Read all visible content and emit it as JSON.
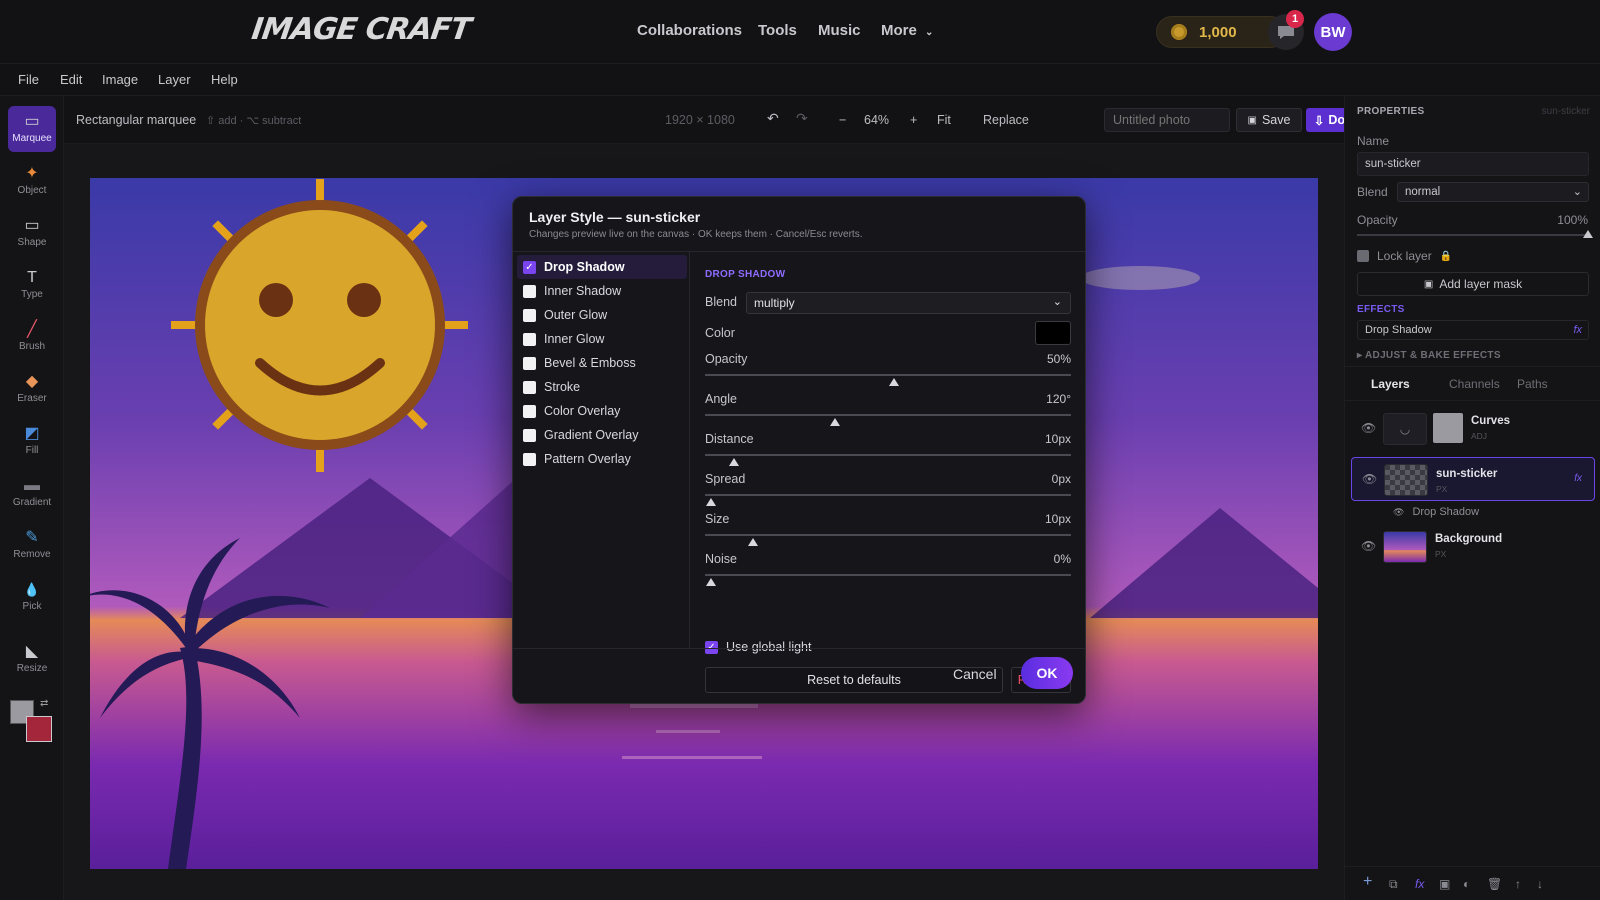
{
  "app": {
    "logo": "IMAGE CRAFT",
    "nav": [
      "Collaborations",
      "Tools",
      "Music",
      "More"
    ],
    "coins": "1,000",
    "notifications": "1",
    "avatar": "BW"
  },
  "menu": [
    "File",
    "Edit",
    "Image",
    "Layer",
    "Help"
  ],
  "tools": [
    {
      "label": "Marquee",
      "icon": "marquee-icon",
      "glyph": "▭",
      "active": true
    },
    {
      "label": "Object",
      "icon": "object-icon",
      "glyph": "✦"
    },
    {
      "label": "Shape",
      "icon": "shape-icon",
      "glyph": "▭"
    },
    {
      "label": "Type",
      "icon": "type-icon",
      "glyph": "T"
    },
    {
      "label": "Brush",
      "icon": "brush-icon",
      "glyph": "╱"
    },
    {
      "label": "Eraser",
      "icon": "eraser-icon",
      "glyph": "◆"
    },
    {
      "label": "Fill",
      "icon": "fill-icon",
      "glyph": "◩"
    },
    {
      "label": "Gradient",
      "icon": "gradient-icon",
      "glyph": "▬"
    },
    {
      "label": "Remove",
      "icon": "remove-icon",
      "glyph": "✎"
    },
    {
      "label": "Pick",
      "icon": "pick-icon",
      "glyph": "💧"
    },
    {
      "label": "Resize",
      "icon": "resize-icon",
      "glyph": "◣"
    }
  ],
  "colors": {
    "foreground": "#9a9aa0",
    "background": "#a3263a",
    "accent": "#6a45e8",
    "danger": "#ef4d6a"
  },
  "options": {
    "tool_name": "Rectangular marquee",
    "tool_hint": "⇧ add · ⌥ subtract",
    "dimensions": "1920 × 1080",
    "zoom": "64%",
    "fit": "Fit",
    "replace": "Replace",
    "title_placeholder": "Untitled photo",
    "save": "Save",
    "download": "Download"
  },
  "dialog": {
    "title": "Layer Style — sun-sticker",
    "subtitle": "Changes preview live on the canvas · OK keeps them · Cancel/Esc reverts.",
    "styles": [
      {
        "label": "Drop Shadow",
        "checked": true
      },
      {
        "label": "Inner Shadow",
        "checked": false
      },
      {
        "label": "Outer Glow",
        "checked": false
      },
      {
        "label": "Inner Glow",
        "checked": false
      },
      {
        "label": "Bevel & Emboss",
        "checked": false
      },
      {
        "label": "Stroke",
        "checked": false
      },
      {
        "label": "Color Overlay",
        "checked": false
      },
      {
        "label": "Gradient Overlay",
        "checked": false
      },
      {
        "label": "Pattern Overlay",
        "checked": false
      }
    ],
    "section": "DROP SHADOW",
    "blend_label": "Blend",
    "blend_value": "multiply",
    "color_label": "Color",
    "shadow_color": "#000000",
    "sliders": [
      {
        "label": "Opacity",
        "value": "50%",
        "fraction": 0.5
      },
      {
        "label": "Angle",
        "value": "120°",
        "fraction": 0.34
      },
      {
        "label": "Distance",
        "value": "10px",
        "fraction": 0.064
      },
      {
        "label": "Spread",
        "value": "0px",
        "fraction": 0.0
      },
      {
        "label": "Size",
        "value": "10px",
        "fraction": 0.115
      },
      {
        "label": "Noise",
        "value": "0%",
        "fraction": 0.0
      }
    ],
    "global_light": "Use global light",
    "reset": "Reset to defaults",
    "remove": "Remove",
    "cancel": "Cancel",
    "ok": "OK"
  },
  "properties": {
    "heading": "PROPERTIES",
    "layer_id": "sun-sticker",
    "name_label": "Name",
    "name_value": "sun-sticker",
    "blend_label": "Blend",
    "blend_value": "normal",
    "opacity_label": "Opacity",
    "opacity_value": "100%",
    "lock": "Lock layer",
    "mask": "Add layer mask",
    "effects_heading": "EFFECTS",
    "effect": "Drop Shadow",
    "fx": "fx",
    "adjust": "ADJUST & BAKE EFFECTS"
  },
  "layers": {
    "tabs": [
      "Layers",
      "Channels",
      "Paths"
    ],
    "items": [
      {
        "name": "Curves",
        "kind": "ADJ"
      },
      {
        "name": "sun-sticker",
        "kind": "PX",
        "fx": "fx"
      },
      {
        "name": "Background",
        "kind": "PX"
      }
    ],
    "sub_effect": "Drop Shadow"
  }
}
